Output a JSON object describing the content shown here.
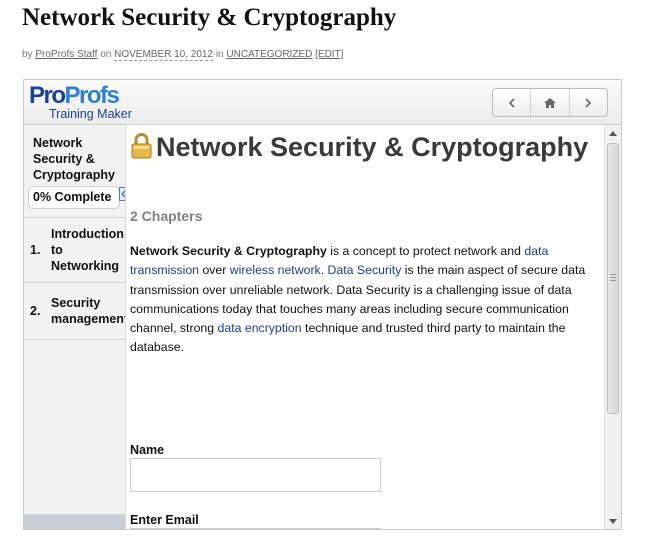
{
  "post": {
    "title": "Network Security & Cryptography",
    "meta_by": "by",
    "author": "ProProfs Staff",
    "meta_on": "on",
    "date": "NOVEMBER 10, 2012",
    "meta_in": "in",
    "category": "UNCATEGORIZED",
    "edit": "[EDIT]"
  },
  "widget": {
    "logo": {
      "brand_a": "Pro",
      "brand_b": "Profs",
      "subtitle": "Training Maker"
    },
    "nav": {
      "back_icon": "chevron-left-icon",
      "home_icon": "home-icon",
      "forward_icon": "chevron-right-icon"
    },
    "sidebar": {
      "course_title": "Network Security & Cryptography",
      "progress_label": "0% Complete",
      "progress": 0,
      "chapters": [
        {
          "num": "1.",
          "label_lines": [
            "Introduction",
            "to",
            "Networking"
          ]
        },
        {
          "num": "2.",
          "label_lines": [
            "Security",
            "management"
          ]
        }
      ]
    },
    "content": {
      "title": "Network Security & Cryptography",
      "chapters_count": "2 Chapters",
      "desc": {
        "p1_bold": "Network Security & Cryptography",
        "p1_a": " is a concept to protect network and ",
        "link1": "data transmission",
        "p1_b": " over ",
        "link2": "wireless network",
        "p1_c": ". ",
        "link3": "Data Security",
        "p1_d": " is the main aspect of secure data transmission over unreliable network. Data Security is a challenging issue of data communications today that touches many areas including secure communication channel, strong ",
        "link4": "data encryption",
        "p1_e": " technique and trusted third party to maintain the database."
      },
      "form": {
        "name_label": "Name",
        "name_value": "",
        "email_label": "Enter Email",
        "email_value": ""
      }
    },
    "colors": {
      "link": "#1f3b8f",
      "brand_dark": "#1b3f9a",
      "brand_light": "#2f7fd8"
    }
  }
}
